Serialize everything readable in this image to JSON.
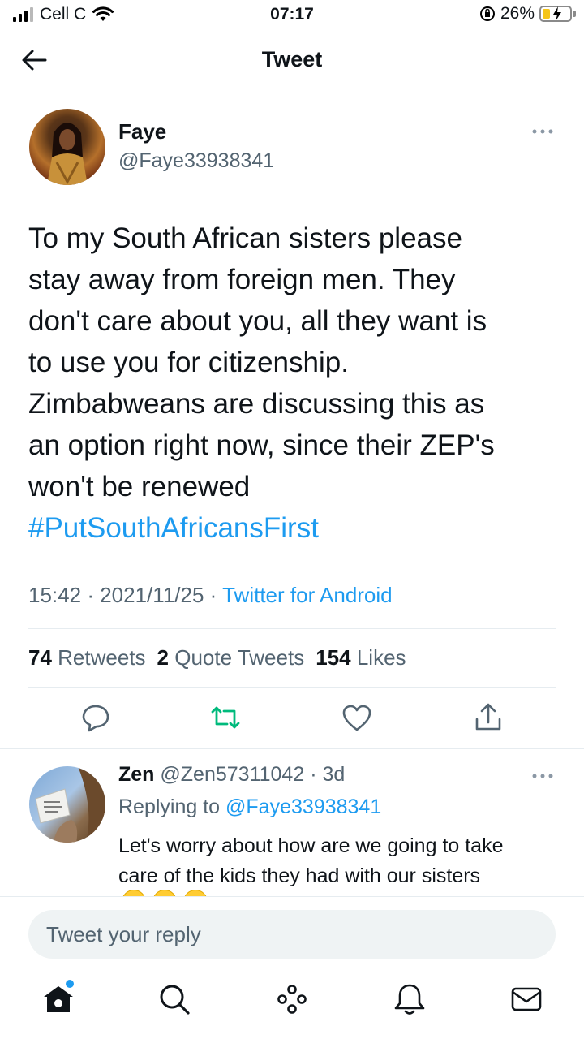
{
  "status_bar": {
    "carrier": "Cell C",
    "time": "07:17",
    "battery_percent": "26%",
    "battery_level": 0.26
  },
  "header": {
    "title": "Tweet"
  },
  "tweet": {
    "author_name": "Faye",
    "author_handle": "@Faye33938341",
    "text_lines": [
      "To my South African sisters please",
      "stay away from foreign men. They",
      "don't care about you, all they want is",
      "to use you for citizenship.",
      "Zimbabweans are discussing this as",
      "an option right now, since their ZEP's",
      "won't be renewed"
    ],
    "hashtag": "#PutSouthAfricansFirst",
    "time": "15:42",
    "date": "2021/11/25",
    "separator": "·",
    "source": "Twitter for Android",
    "retweets_count": "74",
    "retweets_label": "Retweets",
    "quotes_count": "2",
    "quotes_label": "Quote Tweets",
    "likes_count": "154",
    "likes_label": "Likes"
  },
  "reply": {
    "author_name": "Zen",
    "author_handle": "@Zen57311042",
    "age": "· 3d",
    "replying_to_label": "Replying to",
    "replying_to_handle": "@Faye33938341",
    "text_lines": [
      "Let's worry about how are we going to take",
      "care of the kids they had with our sisters"
    ]
  },
  "composer": {
    "placeholder": "Tweet your reply"
  },
  "colors": {
    "accent": "#1d9bf0",
    "retweet_green": "#00ba7c",
    "secondary_text": "#536471"
  }
}
